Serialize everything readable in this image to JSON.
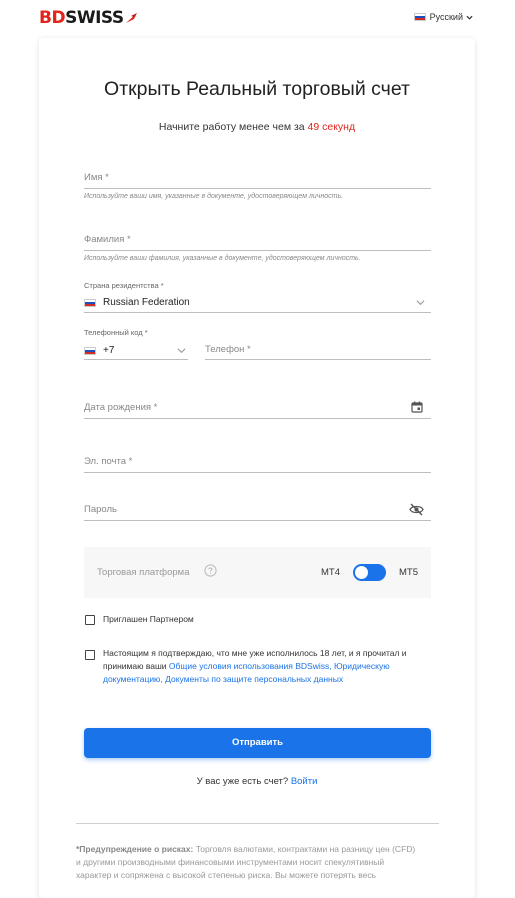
{
  "header": {
    "logo_bd": "BD",
    "logo_swiss": "SWISS",
    "language": "Русский"
  },
  "form": {
    "title": "Открыть Реальный торговый счет",
    "subtitle_prefix": "Начните работу менее чем за ",
    "subtitle_highlight": "49 секунд",
    "first_name": {
      "placeholder": "Имя *",
      "hint": "Используйте ваши имя, указанные в документе, удостоверяющем личность."
    },
    "last_name": {
      "placeholder": "Фамилия *",
      "hint": "Используйте ваши фамилия, указанные в документе, удостоверяющем личность."
    },
    "country": {
      "label": "Страна резидентства *",
      "value": "Russian Federation"
    },
    "phone_code": {
      "label": "Телефонный код *",
      "value": "+7"
    },
    "phone": {
      "placeholder": "Телефон *"
    },
    "birth_date": {
      "placeholder": "Дата рождения *"
    },
    "email": {
      "placeholder": "Эл. почта *"
    },
    "password": {
      "placeholder": "Пароль"
    },
    "platform": {
      "label": "Торговая платформа",
      "option_left": "MT4",
      "option_right": "MT5",
      "selected": "MT5"
    },
    "partner_checkbox": "Приглашен Партнером",
    "terms_checkbox": {
      "line1": "Настоящим я подтверждаю, что мне уже исполнилось 18 лет, и я прочитал и",
      "line2_prefix": "принимаю ваши ",
      "link1": "Общие условия использования BDSwiss, Юридическую",
      "link2": "документацию, Документы по защите персональных данных"
    },
    "submit_label": "Отправить",
    "login_prompt": "У вас уже есть счет? ",
    "login_link": "Войти"
  },
  "risk_warning": {
    "title": "*Предупреждение о рисках:",
    "text1": " Торговля валютами, контрактами на разницу цен (CFD)",
    "text2": "и другими производными финансовыми инструментами носит спекулятивный",
    "text3": "характер и сопряжена с высокой степенью риска. Вы можете потерять весь"
  },
  "colors": {
    "brand_red": "#e1251b",
    "accent_blue": "#1a73e8",
    "flag_ru": [
      "#ffffff",
      "#1f4fbf",
      "#d52b1e"
    ]
  }
}
